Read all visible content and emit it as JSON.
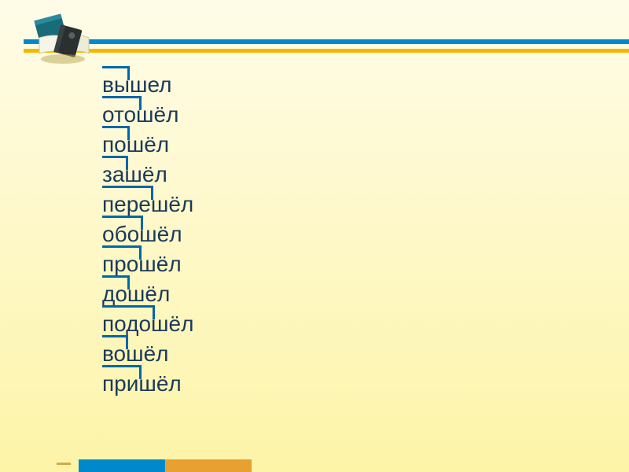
{
  "words": [
    {
      "prefix": "вы",
      "text": "вышел",
      "markWidth": 35
    },
    {
      "prefix": "ото",
      "text": "отошёл",
      "markWidth": 50
    },
    {
      "prefix": "по",
      "text": "пошёл",
      "markWidth": 35
    },
    {
      "prefix": "за",
      "text": "зашёл",
      "markWidth": 33
    },
    {
      "prefix": "пере",
      "text": "перешёл",
      "markWidth": 65
    },
    {
      "prefix": "обо",
      "text": "обошёл",
      "markWidth": 52
    },
    {
      "prefix": "про",
      "text": "прошёл",
      "markWidth": 50
    },
    {
      "prefix": "до",
      "text": "дошёл",
      "markWidth": 35
    },
    {
      "prefix": "подо",
      "text": "подошёл",
      "markWidth": 67
    },
    {
      "prefix": "во",
      "text": "вошёл",
      "markWidth": 33
    },
    {
      "prefix": "при",
      "text": "пришёл",
      "markWidth": 50
    }
  ]
}
